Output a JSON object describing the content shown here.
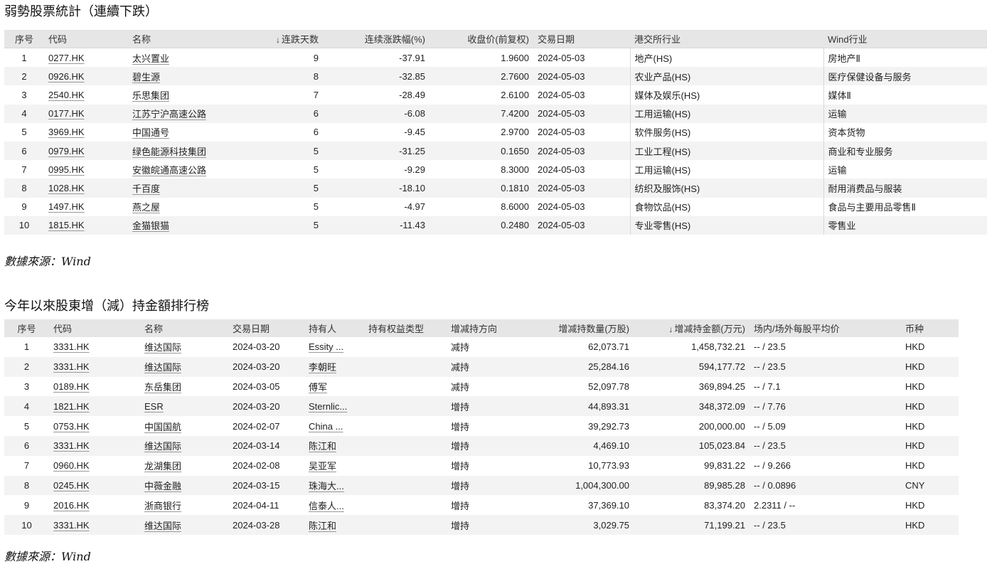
{
  "section1": {
    "title": "弱勢股票統計（連續下跌）",
    "headers": [
      "序号",
      "代码",
      "名称",
      "连跌天数",
      "连续涨跌幅(%)",
      "收盘价(前复权)",
      "交易日期",
      "港交所行业",
      "Wind行业"
    ],
    "sort_icon": "sort-desc-icon",
    "rows": [
      [
        "1",
        "0277.HK",
        "太兴置业",
        "9",
        "-37.91",
        "1.9600",
        "2024-05-03",
        "地产(HS)",
        "房地产Ⅱ"
      ],
      [
        "2",
        "0926.HK",
        "碧生源",
        "8",
        "-32.85",
        "2.7600",
        "2024-05-03",
        "农业产品(HS)",
        "医疗保健设备与服务"
      ],
      [
        "3",
        "2540.HK",
        "乐思集团",
        "7",
        "-28.49",
        "2.6100",
        "2024-05-03",
        "媒体及娱乐(HS)",
        "媒体Ⅱ"
      ],
      [
        "4",
        "0177.HK",
        "江苏宁沪高速公路",
        "6",
        "-6.08",
        "7.4200",
        "2024-05-03",
        "工用运输(HS)",
        "运输"
      ],
      [
        "5",
        "3969.HK",
        "中国通号",
        "6",
        "-9.45",
        "2.9700",
        "2024-05-03",
        "软件服务(HS)",
        "资本货物"
      ],
      [
        "6",
        "0979.HK",
        "绿色能源科技集团",
        "5",
        "-31.25",
        "0.1650",
        "2024-05-03",
        "工业工程(HS)",
        "商业和专业服务"
      ],
      [
        "7",
        "0995.HK",
        "安徽皖通高速公路",
        "5",
        "-9.29",
        "8.3000",
        "2024-05-03",
        "工用运输(HS)",
        "运输"
      ],
      [
        "8",
        "1028.HK",
        "千百度",
        "5",
        "-18.10",
        "0.1810",
        "2024-05-03",
        "纺织及服饰(HS)",
        "耐用消费品与服装"
      ],
      [
        "9",
        "1497.HK",
        "燕之屋",
        "5",
        "-4.97",
        "8.6000",
        "2024-05-03",
        "食物饮品(HS)",
        "食品与主要用品零售Ⅱ"
      ],
      [
        "10",
        "1815.HK",
        "金猫银猫",
        "5",
        "-11.43",
        "0.2480",
        "2024-05-03",
        "专业零售(HS)",
        "零售业"
      ]
    ],
    "source": "數據來源：Wind"
  },
  "section2": {
    "title": "今年以來股東增（減）持金額排行榜",
    "headers": [
      "序号",
      "代码",
      "名称",
      "交易日期",
      "持有人",
      "持有权益类型",
      "增减持方向",
      "增减持数量(万股)",
      "增减持金额(万元)",
      "场内/场外每股平均价",
      "币种"
    ],
    "sort_icon": "sort-desc-icon",
    "rows": [
      [
        "1",
        "3331.HK",
        "维达国际",
        "2024-03-20",
        "Essity ...",
        "",
        "减持",
        "62,073.71",
        "1,458,732.21",
        "-- / 23.5",
        "HKD"
      ],
      [
        "2",
        "3331.HK",
        "维达国际",
        "2024-03-20",
        "李朝旺",
        "",
        "减持",
        "25,284.16",
        "594,177.72",
        "-- / 23.5",
        "HKD"
      ],
      [
        "3",
        "0189.HK",
        "东岳集团",
        "2024-03-05",
        "傅军",
        "",
        "减持",
        "52,097.78",
        "369,894.25",
        "-- / 7.1",
        "HKD"
      ],
      [
        "4",
        "1821.HK",
        "ESR",
        "2024-03-20",
        "Sternlic...",
        "",
        "增持",
        "44,893.31",
        "348,372.09",
        "-- / 7.76",
        "HKD"
      ],
      [
        "5",
        "0753.HK",
        "中国国航",
        "2024-02-07",
        "China ...",
        "",
        "增持",
        "39,292.73",
        "200,000.00",
        "-- / 5.09",
        "HKD"
      ],
      [
        "6",
        "3331.HK",
        "维达国际",
        "2024-03-14",
        "陈江和",
        "",
        "增持",
        "4,469.10",
        "105,023.84",
        "-- / 23.5",
        "HKD"
      ],
      [
        "7",
        "0960.HK",
        "龙湖集团",
        "2024-02-08",
        "吴亚军",
        "",
        "增持",
        "10,773.93",
        "99,831.22",
        "-- / 9.266",
        "HKD"
      ],
      [
        "8",
        "0245.HK",
        "中薇金融",
        "2024-03-15",
        "珠海大...",
        "",
        "增持",
        "1,004,300.00",
        "89,985.28",
        "-- / 0.0896",
        "CNY"
      ],
      [
        "9",
        "2016.HK",
        "浙商银行",
        "2024-04-11",
        "信泰人...",
        "",
        "增持",
        "37,369.10",
        "83,374.20",
        "2.2311 / --",
        "HKD"
      ],
      [
        "10",
        "3331.HK",
        "维达国际",
        "2024-03-28",
        "陈江和",
        "",
        "增持",
        "3,029.75",
        "71,199.21",
        "-- / 23.5",
        "HKD"
      ]
    ],
    "source": "數據來源：Wind"
  }
}
